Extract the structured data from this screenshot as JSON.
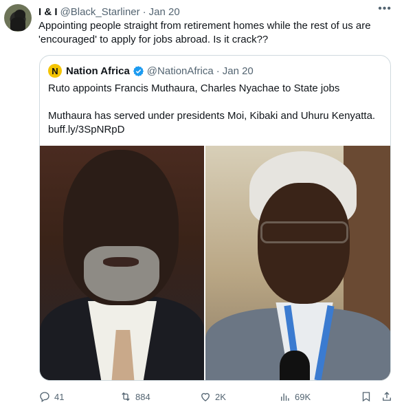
{
  "tweet": {
    "display_name": "I & I",
    "handle": "@Black_Starliner",
    "separator": "·",
    "time": "Jan 20",
    "more_icon": "more-horizontal-icon",
    "text": "Appointing people straight from retirement homes while the rest of us are 'encouraged' to apply for jobs abroad. Is it crack??"
  },
  "quoted": {
    "logo_letter": "N",
    "display_name": "Nation Africa",
    "verified_icon": "verified-badge-icon",
    "verified_color": "#1d9bf0",
    "handle": "@NationAfrica",
    "separator": "·",
    "time": "Jan 20",
    "text_line1": "Ruto appoints Francis Muthaura, Charles Nyachae to State jobs",
    "text_line2": "Muthaura has served under presidents Moi, Kibaki and Uhuru Kenyatta. buff.ly/3SpNRpD"
  },
  "actions": {
    "reply_count": "41",
    "retweet_count": "884",
    "like_count": "2K",
    "views_count": "69K"
  }
}
